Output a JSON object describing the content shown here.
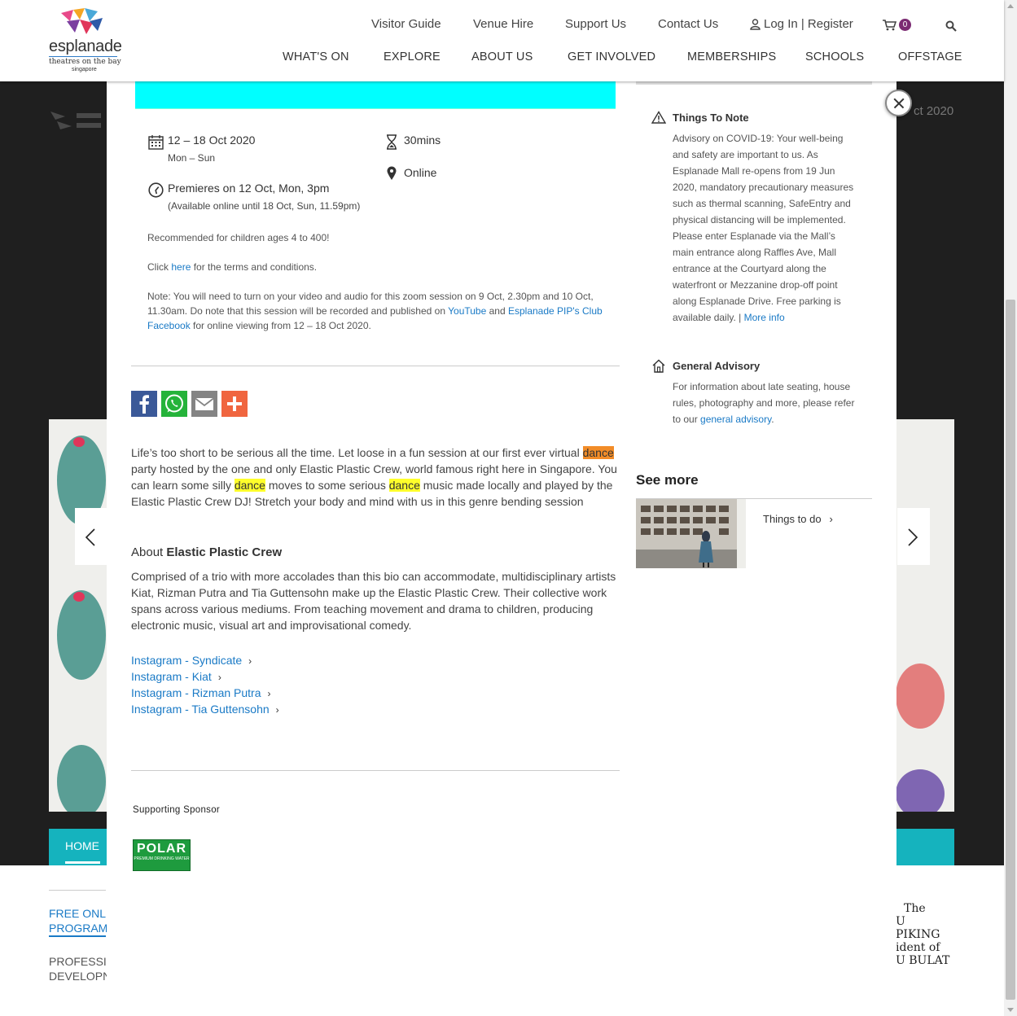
{
  "header": {
    "logo_name": "esplanade",
    "logo_tagline": "theatres on the bay",
    "logo_location": "singapore",
    "utility_nav": [
      "Visitor Guide",
      "Venue Hire",
      "Support Us",
      "Contact Us",
      "Log In | Register"
    ],
    "cart_count": "0",
    "main_nav": [
      "WHAT'S ON",
      "EXPLORE",
      "ABOUT US",
      "GET INVOLVED",
      "MEMBERSHIPS",
      "SCHOOLS",
      "OFFSTAGE"
    ]
  },
  "background": {
    "date_partial": "ct 2020",
    "home_tab": "HOME",
    "side_links": [
      "FREE ONLI",
      "PROGRAM",
      "PROFESSIO",
      "DEVELOPN"
    ],
    "sketch_text": [
      "The",
      "U PIKING",
      "ident of",
      "U BULAT"
    ]
  },
  "event": {
    "date_range": "12 – 18 Oct 2020",
    "days": "Mon – Sun",
    "duration": "30mins",
    "location": "Online",
    "premiere": "Premieres on 12 Oct, Mon, 3pm",
    "availability": "(Available online until 18 Oct, Sun, 11.59pm)",
    "recommended": "Recommended for children ages 4 to 400!",
    "terms_prefix": "Click ",
    "terms_link": "here",
    "terms_suffix": " for the terms and conditions.",
    "note_prefix": "Note: You will need to turn on your video and audio for this zoom session on 9 Oct, 2.30pm and 10 Oct, 11.30am. Do note that this session will be recorded and published on ",
    "note_link1": "YouTube",
    "note_mid": " and ",
    "note_link2": "Esplanade PIP's Club Facebook",
    "note_suffix": " for online viewing from 12 – 18 Oct 2020."
  },
  "share": {
    "buttons": [
      "facebook",
      "whatsapp",
      "email",
      "more"
    ]
  },
  "description": {
    "p1": "Life’s too short to be serious all the time. Let loose in a fun session at our first ever virtual ",
    "hl1": "dance",
    "p2": " party hosted by the one and only Elastic Plastic Crew, world famous right here in Singapore. You can learn some silly ",
    "hl2": "dance",
    "p3": " moves to some serious ",
    "hl3": "dance",
    "p4": " music made locally and played by the Elastic Plastic Crew DJ! Stretch your body and mind with us in this genre bending session"
  },
  "about": {
    "title_light": "About ",
    "title_bold": "Elastic Plastic Crew",
    "body": "Comprised of a trio with more accolades than this bio can accommodate, multidisciplinary artists Kiat, Rizman Putra and Tia Guttensohn make up the Elastic Plastic Crew. Their collective work spans across various mediums. From teaching movement and drama to children, producing electronic music, visual art and improvisational comedy.",
    "links": [
      "Instagram - Syndicate",
      "Instagram - Kiat",
      "Instagram - Rizman Putra",
      "Instagram - Tia Guttensohn"
    ]
  },
  "sponsor": {
    "label": "Supporting Sponsor",
    "logo_text": "POLAR",
    "logo_sub": "PREMIUM DRINKING WATER"
  },
  "sidebar": {
    "things_title": "Things To Note",
    "things_body": "Advisory on COVID-19: Your well-being and safety are important to us. As Esplanade Mall re-opens from 19 Jun 2020, mandatory precautionary measures such as thermal scanning, SafeEntry and physical distancing will be implemented. Please enter Esplanade via the Mall’s main entrance along Raffles Ave, Mall entrance at the Courtyard along the waterfront or Mezzanine drop-off point along Esplanade Drive. Free parking is available daily. | ",
    "things_link": "More info",
    "advisory_title": "General Advisory",
    "advisory_body": "For information about late seating, house rules, photography and more, please refer to our ",
    "advisory_link": "general advisory",
    "advisory_end": ".",
    "see_more": "See more",
    "see_more_item": "Things to do"
  }
}
